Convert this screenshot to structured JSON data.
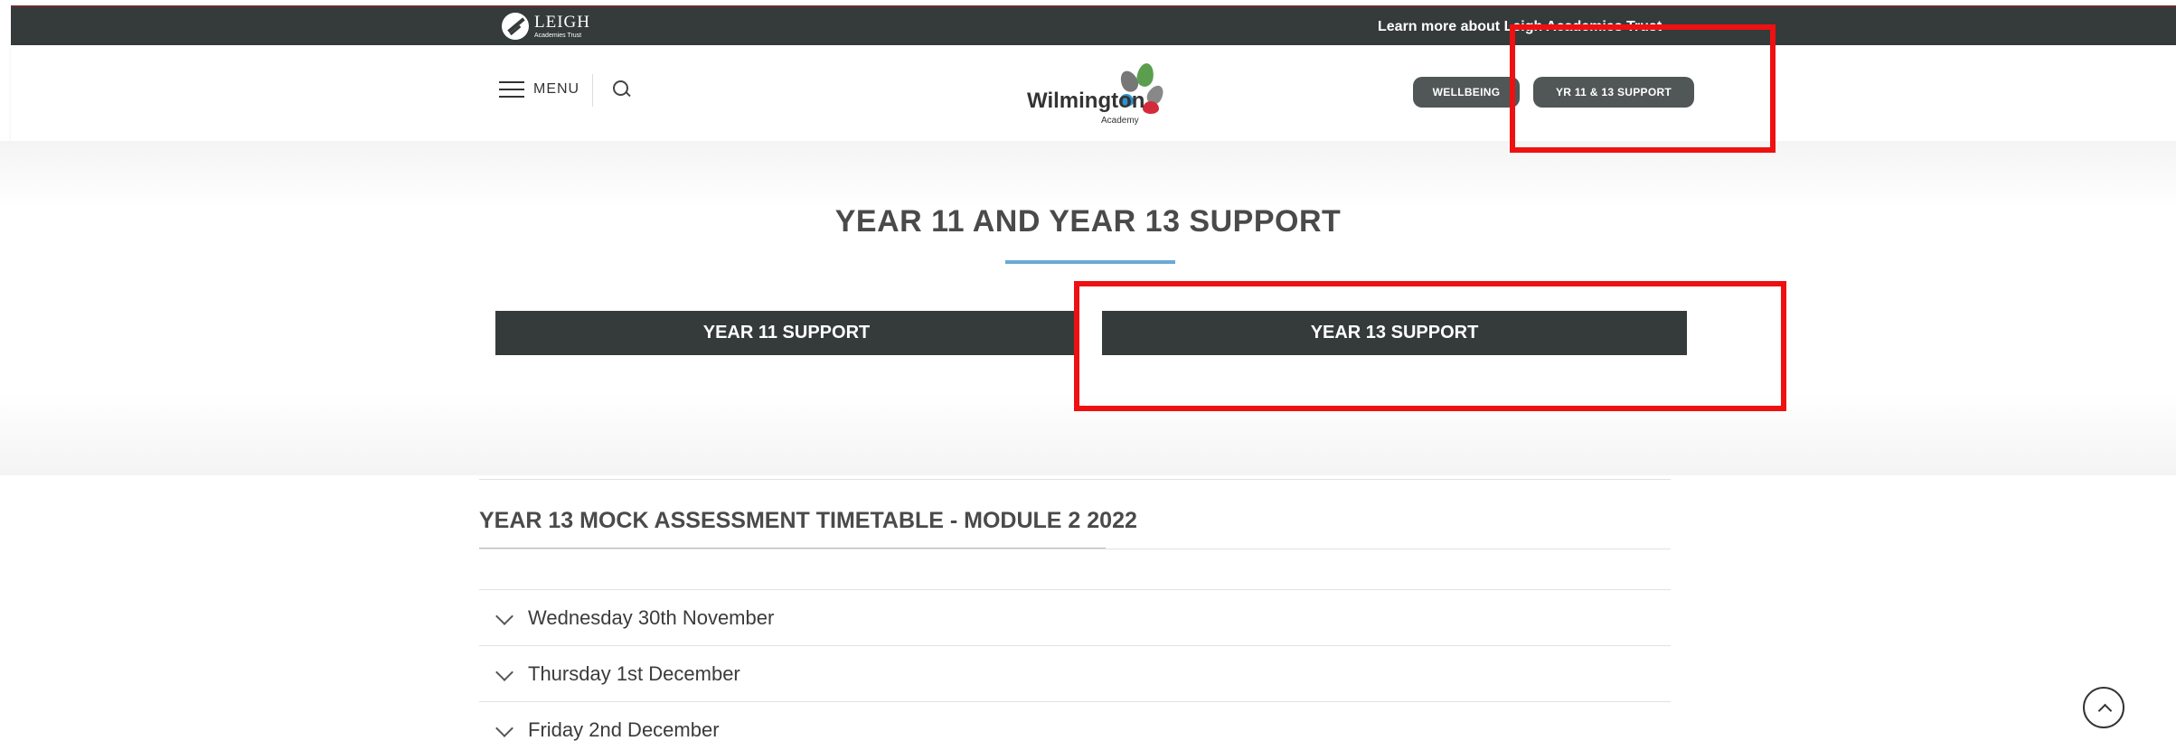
{
  "topbar": {
    "brand": "LEIGH",
    "brand_sub": "Academies Trust",
    "learn_more": "Learn more about Leigh Academies Trust"
  },
  "header": {
    "menu_label": "MENU",
    "logo_name": "Wilmington",
    "logo_sub": "Academy",
    "wellbeing_label": "WELLBEING",
    "support_label": "YR 11 & 13 SUPPORT"
  },
  "hero": {
    "title": "YEAR 11 AND YEAR 13 SUPPORT",
    "tabs": [
      {
        "label": "YEAR 11 SUPPORT"
      },
      {
        "label": "YEAR 13 SUPPORT"
      }
    ]
  },
  "content": {
    "title": "YEAR 13 MOCK ASSESSMENT TIMETABLE - MODULE 2 2022",
    "accordion": [
      {
        "label": "Wednesday 30th November"
      },
      {
        "label": "Thursday 1st December"
      },
      {
        "label": "Friday 2nd December"
      }
    ]
  },
  "colors": {
    "dark_bar": "#343b3a",
    "accent_blue": "#6aa9d6",
    "highlight_red": "#ee1111"
  }
}
